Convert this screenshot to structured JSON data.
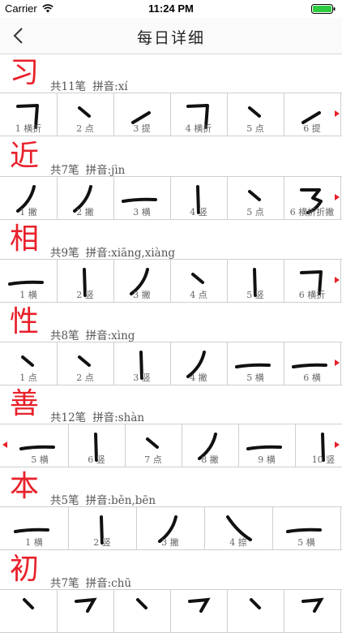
{
  "status": {
    "carrier": "Carrier",
    "time": "11:24 PM"
  },
  "nav": {
    "title": "每日详细"
  },
  "sections": [
    {
      "char": "习",
      "strokes": "共11笔",
      "pinyin": "拼音:xí",
      "cells": [
        "1 横折",
        "2 点",
        "3 提",
        "4 横折",
        "5 点",
        "6 提"
      ]
    },
    {
      "char": "近",
      "strokes": "共7笔",
      "pinyin": "拼音:jìn",
      "cells": [
        "1 撇",
        "2 撇",
        "3 横",
        "4 竖",
        "5 点",
        "6 横折折撇"
      ]
    },
    {
      "char": "相",
      "strokes": "共9笔",
      "pinyin": "拼音:xiāng,xiàng",
      "cells": [
        "1 横",
        "2 竖",
        "3 撇",
        "4 点",
        "5 竖",
        "6 横折"
      ]
    },
    {
      "char": "性",
      "strokes": "共8笔",
      "pinyin": "拼音:xìng",
      "cells": [
        "1 点",
        "2 点",
        "3 竖",
        "4 撇",
        "5 横",
        "6 横"
      ]
    },
    {
      "char": "善",
      "strokes": "共12笔",
      "pinyin": "拼音:shàn",
      "cells": [
        "5 横",
        "6 竖",
        "7 点",
        "8 撇",
        "9 横",
        "10 竖"
      ]
    },
    {
      "char": "本",
      "strokes": "共5笔",
      "pinyin": "拼音:běn,bēn",
      "cells": [
        "1 横",
        "2 竖",
        "3 撇",
        "4 捺",
        "5 横"
      ]
    },
    {
      "char": "初",
      "strokes": "共7笔",
      "pinyin": "拼音:chū",
      "cells": []
    }
  ],
  "colors": {
    "accent": "#e8202a",
    "stroke": "#111111"
  }
}
